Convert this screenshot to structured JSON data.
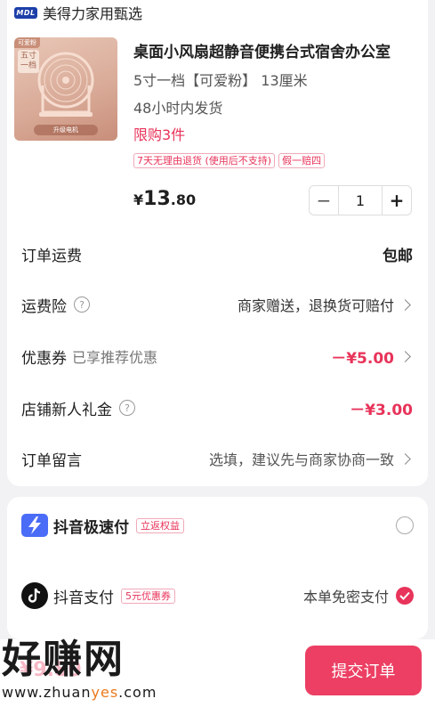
{
  "shop": {
    "logo_text": "MDL",
    "name": "美得力家用甄选"
  },
  "product": {
    "thumb_tag_left": "可爱粉",
    "thumb_tag_mid": "五寸\n一档",
    "thumb_tag_bottom": "升级电机",
    "title": "桌面小风扇超静音便携台式宿舍办公室",
    "spec": "5寸一档【可爱粉】 13厘米",
    "shipping": "48小时内发货",
    "limit": "限购3件",
    "tags": [
      "7天无理由退货 (使用后不支持)",
      "假一赔四"
    ],
    "price_currency": "¥",
    "price_int": "13",
    "price_dec": ".80",
    "quantity": "1"
  },
  "rows": {
    "shipping_fee": {
      "label": "订单运费",
      "value": "包邮"
    },
    "insurance": {
      "label": "运费险",
      "value": "商家赠送，退换货可赔付"
    },
    "coupon": {
      "label": "优惠券",
      "sub": "已享推荐优惠",
      "value": "－¥5.00"
    },
    "newcomer": {
      "label": "店铺新人礼金",
      "value": "－¥3.00"
    },
    "message": {
      "label": "订单留言",
      "value": "选填，建议先与商家协商一致"
    }
  },
  "payment": {
    "fast_pay": {
      "name": "抖音极速付",
      "badge": "立返权益"
    },
    "douyin_pay": {
      "name": "抖音支付",
      "badge": "5元优惠券",
      "right": "本单免密支付"
    }
  },
  "footer": {
    "total": "¥9.80",
    "submit_label": "提交订单"
  },
  "watermark": {
    "big": "好赚网",
    "url_pre": "www.zhuan",
    "url_y": "yes",
    "url_post": ".com"
  },
  "colors": {
    "accent": "#e8335a",
    "shop_logo": "#1c3fa8",
    "fast_pay_icon": "#4a6cf7"
  }
}
